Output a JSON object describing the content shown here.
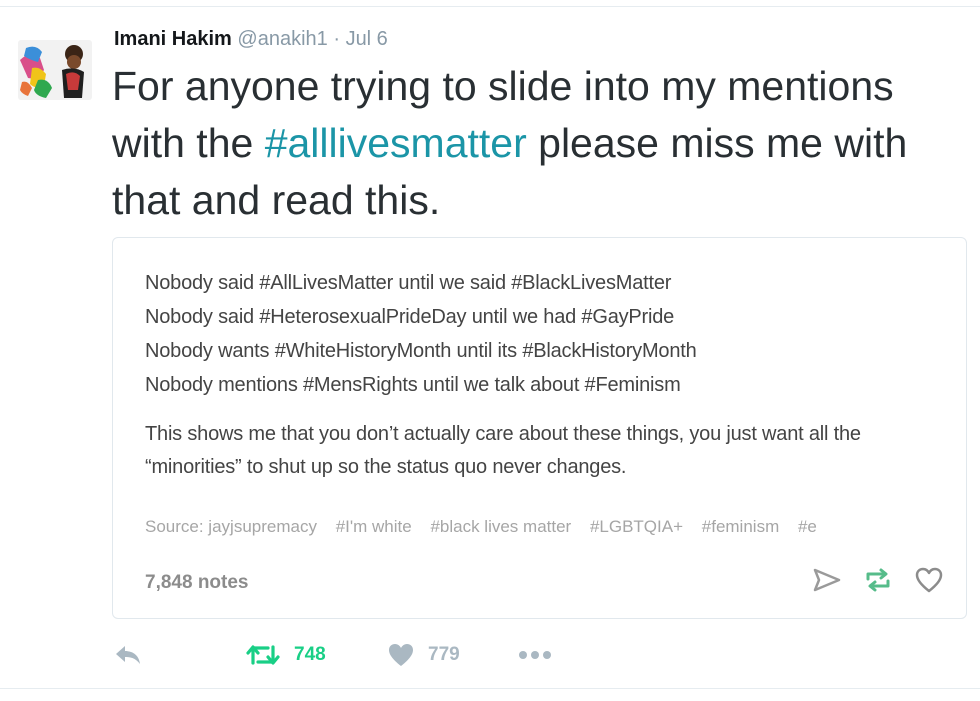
{
  "tweet": {
    "author_name": "Imani Hakim",
    "handle": "@anakih1",
    "separator": "·",
    "date": "Jul 6",
    "text_before": "For anyone trying to slide into my mentions with the ",
    "hashtag": "#alllivesmatter",
    "text_after": " please miss me with that and read this."
  },
  "card": {
    "lines": [
      "Nobody said #AllLivesMatter until we said #BlackLivesMatter",
      "Nobody said #HeterosexualPrideDay until we had #GayPride",
      "Nobody wants #WhiteHistoryMonth until its #BlackHistoryMonth",
      "Nobody mentions #MensRights until we talk about #Feminism"
    ],
    "paragraph": "This shows me that you don’t actually care about these things, you just want all the “minorities” to shut up so the status quo never changes.",
    "source": "Source: jayjsupremacy",
    "tags": [
      "#I'm white",
      "#black lives matter",
      "#LGBTQIA+",
      "#feminism",
      "#e"
    ],
    "notes": "7,848 notes",
    "icons": [
      "send-icon",
      "reblog-icon",
      "heart-outline-icon"
    ]
  },
  "actions": {
    "reply_icon": "reply-icon",
    "retweet_count": "748",
    "like_count": "779",
    "more_icon": "more-icon"
  },
  "colors": {
    "hashtag": "#1b95a7",
    "retweet_green": "#19cf86",
    "muted": "#aab8c2",
    "tumblr_green": "#56bc8a"
  }
}
